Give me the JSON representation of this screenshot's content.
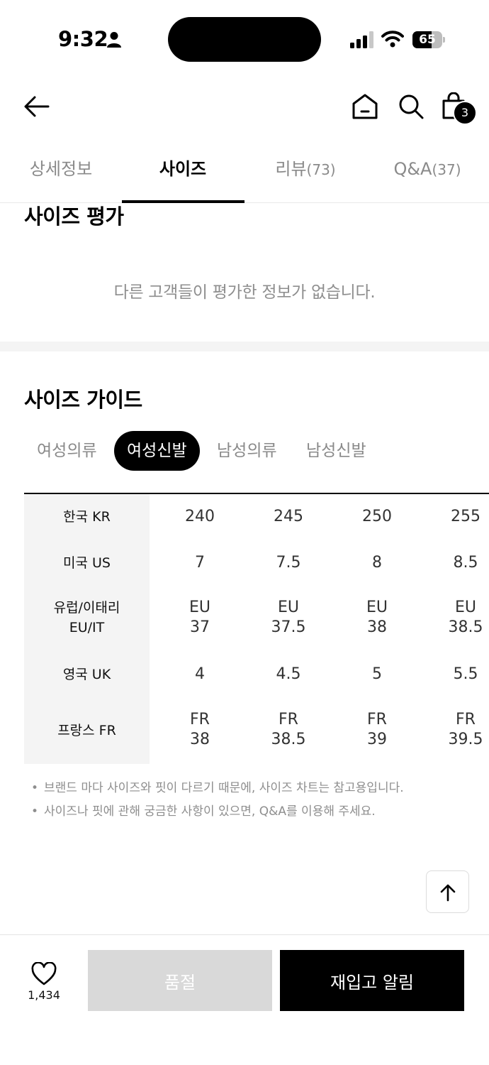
{
  "status_bar": {
    "time": "9:32",
    "battery": "65",
    "battery_level": 0.65
  },
  "header": {
    "cart_count": "3",
    "icons": [
      "back-arrow-icon",
      "home-icon",
      "search-icon",
      "shopping-bag-icon"
    ]
  },
  "tabs": [
    {
      "label": "상세정보",
      "count": ""
    },
    {
      "label": "사이즈",
      "count": ""
    },
    {
      "label": "리뷰",
      "count": "(73)"
    },
    {
      "label": "Q&A",
      "count": "(37)"
    }
  ],
  "active_tab": "사이즈",
  "size_rating": {
    "title": "사이즈 평가",
    "empty_message": "다른 고객들이 평가한 정보가 없습니다."
  },
  "size_guide": {
    "title": "사이즈 가이드",
    "categories": [
      "여성의류",
      "여성신발",
      "남성의류",
      "남성신발"
    ],
    "active_category": "여성신발",
    "rows": [
      {
        "label": "한국 KR",
        "values": [
          "240",
          "245",
          "250",
          "255"
        ]
      },
      {
        "label": "미국 US",
        "values": [
          "7",
          "7.5",
          "8",
          "8.5"
        ]
      },
      {
        "label": "유럽/이태리\nEU/IT",
        "values": [
          "EU\n37",
          "EU\n37.5",
          "EU\n38",
          "EU\n38.5"
        ]
      },
      {
        "label": "영국 UK",
        "values": [
          "4",
          "4.5",
          "5",
          "5.5"
        ]
      },
      {
        "label": "프랑스 FR",
        "values": [
          "FR\n38",
          "FR\n38.5",
          "FR\n39",
          "FR\n39.5"
        ]
      }
    ],
    "notes": [
      "브랜드 마다 사이즈와 핏이 다르기 때문에, 사이즈 차트는 참고용입니다.",
      "사이즈나 핏에 관해 궁금한 사항이 있으면, Q&A를 이용해 주세요."
    ]
  },
  "bottom_bar": {
    "like_count": "1,434",
    "soldout_label": "품절",
    "restock_label": "재입고 알림"
  }
}
